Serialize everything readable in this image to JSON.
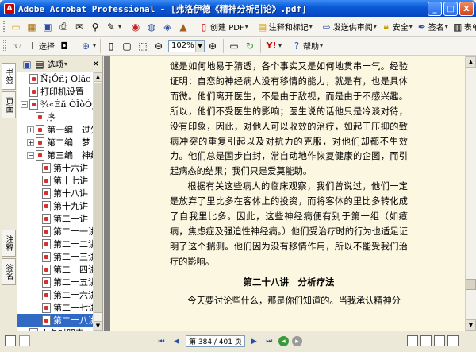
{
  "window": {
    "title": "Adobe Acrobat Professional - [弗洛伊德《精神分析引论》.pdf]",
    "minimize": "_",
    "maximize": "□",
    "close": "X"
  },
  "toolbar1": {
    "create_pdf": "创建 PDF",
    "comments": "注释和标记",
    "send_review": "发送供审阅",
    "security": "安全",
    "sign": "签名",
    "forms": "表单"
  },
  "toolbar2": {
    "select": "选择",
    "zoom": "102%",
    "help": "帮助"
  },
  "tabs": {
    "bookmarks": "书签",
    "pages": "页面",
    "comments": "注释",
    "signatures": "签名"
  },
  "panel": {
    "options": "选项",
    "close": "×",
    "items": [
      {
        "label": "Ñ¡Ôñ¡ Olãc",
        "level": 0,
        "exp": ""
      },
      {
        "label": "打印机设置",
        "level": 0,
        "exp": ""
      },
      {
        "label": "¾«Éñ ÒÎòÓýÂ0",
        "level": 0,
        "exp": "−"
      },
      {
        "label": "序",
        "level": 1,
        "exp": ""
      },
      {
        "label": "第一编　过失",
        "level": 1,
        "exp": "+"
      },
      {
        "label": "第二编　梦",
        "level": 1,
        "exp": "+"
      },
      {
        "label": "第三编　神经",
        "level": 1,
        "exp": "−"
      },
      {
        "label": "第十六讲",
        "level": 2,
        "exp": ""
      },
      {
        "label": "第十七讲",
        "level": 2,
        "exp": ""
      },
      {
        "label": "第十八讲",
        "level": 2,
        "exp": ""
      },
      {
        "label": "第十九讲",
        "level": 2,
        "exp": ""
      },
      {
        "label": "第二十讲",
        "level": 2,
        "exp": ""
      },
      {
        "label": "第二十一讲",
        "level": 2,
        "exp": ""
      },
      {
        "label": "第二十二讲",
        "level": 2,
        "exp": ""
      },
      {
        "label": "第二十三讲",
        "level": 2,
        "exp": ""
      },
      {
        "label": "第二十四讲",
        "level": 2,
        "exp": ""
      },
      {
        "label": "第二十五讲",
        "level": 2,
        "exp": ""
      },
      {
        "label": "第二十六讲",
        "level": 2,
        "exp": ""
      },
      {
        "label": "第二十七讲",
        "level": 2,
        "exp": ""
      },
      {
        "label": "第二十八讲",
        "level": 2,
        "exp": "",
        "selected": true
      },
      {
        "label": "人名对照表",
        "level": 0,
        "exp": ""
      }
    ]
  },
  "document": {
    "para1": "谜是如何地易于猜透，各个事实又是如何地贯串一气。经验证明：自恋的神经病人没有移情的能力，就是有，也是具体而微。他们离开医生，不是由于敌视，而是由于不感兴趣。所以，他们不受医生的影响；医生说的话他只是冷淡对待，没有印象，因此，对他人可以收效的治疗，如起于压抑的致病冲突的重复引起以及对抗力的克服，对他们却都不生效力。他们总是固步自封，常自动地作恢复健康的企图，而引起病态的结果；我们只是爱莫能助。",
    "para2": "根据有关这些病人的临床观察，我们曾说过，他们一定是放弃了里比多在客体上的投资，而将客体的里比多转化成了自我里比多。因此，这些神经病便有别于第一组（如癔病，焦虑症及强迫性神经病。）他们受治疗时的行为也适足证明了这个揣测。他们因为没有移情作用，所以不能受我们治疗的影响。",
    "heading": "第二十八讲　分析疗法",
    "para3": "今天要讨论些什么，那是你们知道的。当我承认精神分"
  },
  "status": {
    "page_display": "第 384 / 401 页"
  }
}
